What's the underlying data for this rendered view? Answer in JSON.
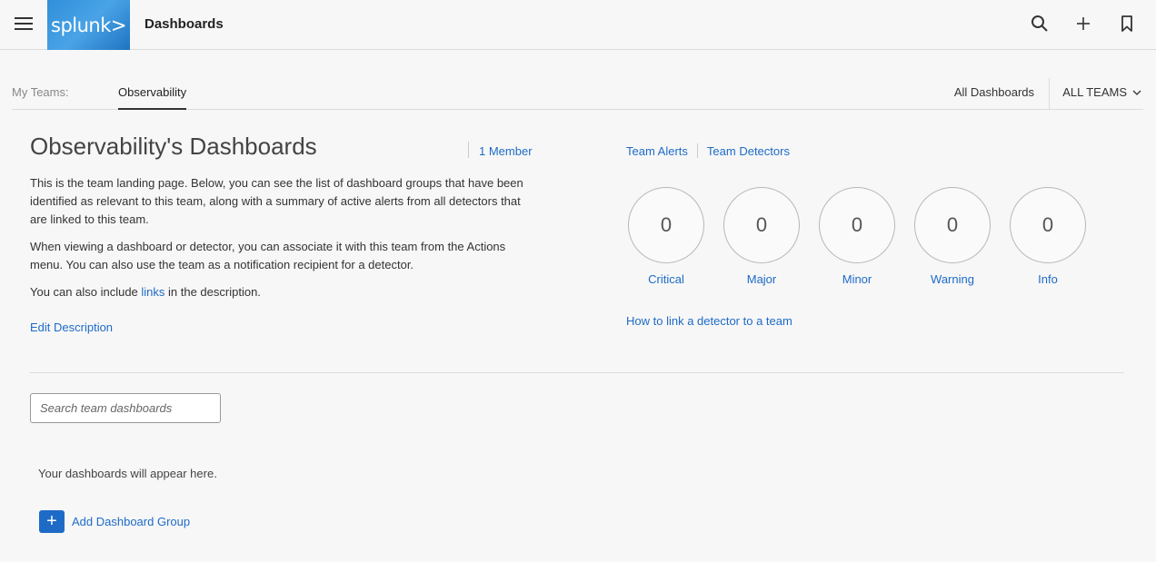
{
  "header": {
    "logo_text": "splunk>",
    "title": "Dashboards",
    "icons": [
      "hamburger-icon",
      "search-icon",
      "plus-icon",
      "bookmark-icon"
    ]
  },
  "tabs": {
    "my_teams_label": "My Teams:",
    "active_tab": "Observability",
    "all_dashboards": "All Dashboards",
    "all_teams": "ALL TEAMS"
  },
  "team": {
    "title": "Observability's Dashboards",
    "member_count": "1 Member",
    "desc_p1": "This is the team landing page. Below, you can see the list of dashboard groups that have been identified as relevant to this team, along with a summary of active alerts from all detectors that are linked to this team.",
    "desc_p2": "When viewing a dashboard or detector, you can associate it with this team from the Actions menu. You can also use the team as a notification recipient for a detector.",
    "desc_p3_before": "You can also include ",
    "desc_p3_link": "links",
    "desc_p3_after": " in the description.",
    "edit_description": "Edit Description",
    "team_alerts": "Team Alerts",
    "team_detectors": "Team Detectors",
    "how_to_link": "How to link a detector to a team"
  },
  "alerts": [
    {
      "label": "Critical",
      "count": "0"
    },
    {
      "label": "Major",
      "count": "0"
    },
    {
      "label": "Minor",
      "count": "0"
    },
    {
      "label": "Warning",
      "count": "0"
    },
    {
      "label": "Info",
      "count": "0"
    }
  ],
  "dashboards": {
    "search_placeholder": "Search team dashboards",
    "empty_message": "Your dashboards will appear here.",
    "add_group_label": "Add Dashboard Group"
  },
  "colors": {
    "link": "#1e6bc7",
    "brand": "#2f8fd9"
  }
}
